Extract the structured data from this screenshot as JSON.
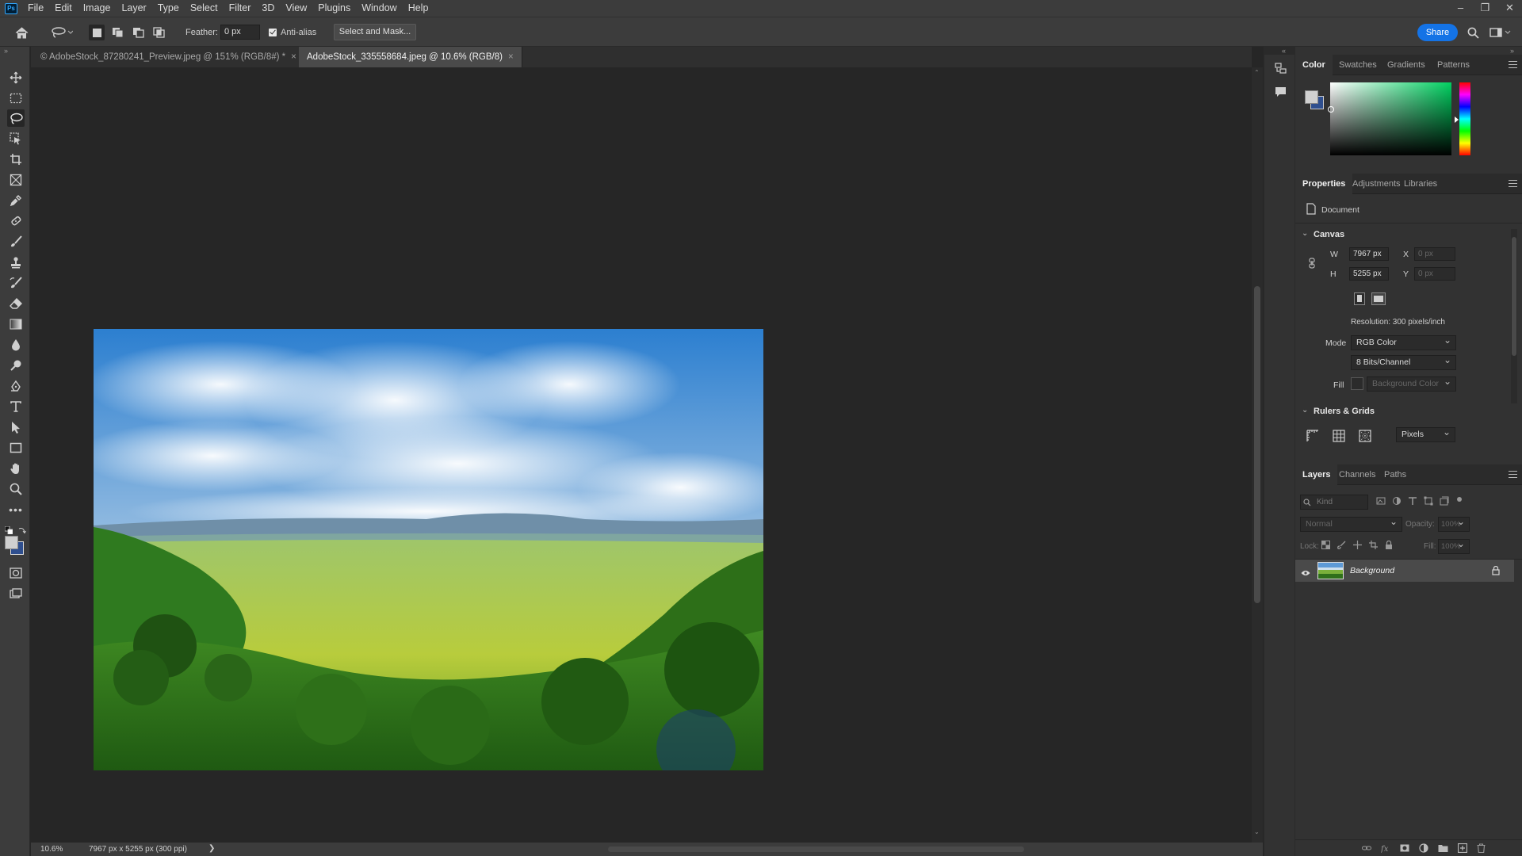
{
  "app": {
    "logo_text": "Ps",
    "menus": [
      "File",
      "Edit",
      "Image",
      "Layer",
      "Type",
      "Select",
      "Filter",
      "3D",
      "View",
      "Plugins",
      "Window",
      "Help"
    ],
    "window_controls": [
      "–",
      "❐",
      "✕"
    ]
  },
  "options": {
    "feather_label": "Feather:",
    "feather_value": "0 px",
    "antialias_label": "Anti-alias",
    "antialias_checked": true,
    "select_mask_label": "Select and Mask...",
    "share_label": "Share"
  },
  "tabs": [
    {
      "label": "© AdobeStock_87280241_Preview.jpeg @ 151% (RGB/8#) *",
      "close": "×",
      "active": false
    },
    {
      "label": "AdobeStock_335558684.jpeg @ 10.6% (RGB/8)",
      "close": "×",
      "active": true
    }
  ],
  "status": {
    "zoom": "10.6%",
    "doc_info": "7967 px x 5255 px (300 ppi)",
    "arrow": "❯"
  },
  "color_panel": {
    "tabs": [
      "Color",
      "Swatches",
      "Gradients",
      "Patterns"
    ],
    "active_tab": "Color",
    "foreground": "#d0d0d0",
    "background": "#2f4f8f",
    "hue_color": "#00d060"
  },
  "properties_panel": {
    "tabs": [
      "Properties",
      "Adjustments",
      "Libraries"
    ],
    "active_tab": "Properties",
    "doc_label": "Document",
    "canvas_section": "Canvas",
    "w_label": "W",
    "w_value": "7967 px",
    "h_label": "H",
    "h_value": "5255 px",
    "x_label": "X",
    "x_placeholder": "0 px",
    "y_label": "Y",
    "y_placeholder": "0 px",
    "resolution": "Resolution: 300 pixels/inch",
    "mode_label": "Mode",
    "mode_value": "RGB Color",
    "bits_value": "8 Bits/Channel",
    "fill_label": "Fill",
    "fill_value": "Background Color",
    "rulers_section": "Rulers & Grids",
    "units_value": "Pixels"
  },
  "layers_panel": {
    "tabs": [
      "Layers",
      "Channels",
      "Paths"
    ],
    "active_tab": "Layers",
    "kind_placeholder": "Kind",
    "blend_mode": "Normal",
    "opacity_label": "Opacity:",
    "opacity_value": "100%",
    "lock_label": "Lock:",
    "fill_label": "Fill:",
    "fill_value": "100%",
    "layers": [
      {
        "name": "Background",
        "visible": true,
        "locked": true
      }
    ],
    "footer_icons": [
      "link-icon",
      "fx-icon",
      "mask-icon",
      "adjustment-icon",
      "group-icon",
      "new-layer-icon",
      "trash-icon"
    ]
  }
}
